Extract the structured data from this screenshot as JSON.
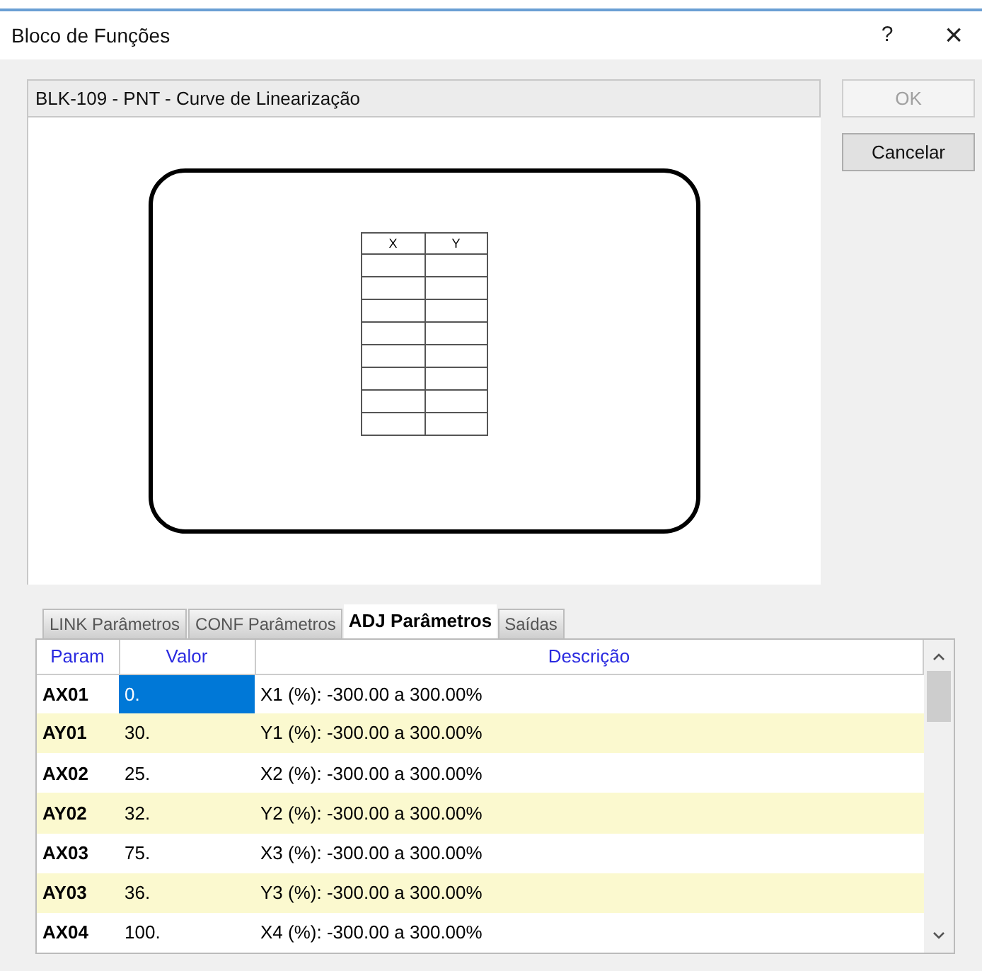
{
  "window": {
    "title": "Bloco de Funções",
    "help": "?",
    "close": "×"
  },
  "block_name": "BLK-109 - PNT - Curve de Linearização",
  "buttons": [
    {
      "label": "OK",
      "disabled": true
    },
    {
      "label": "Cancelar",
      "disabled": false
    }
  ],
  "diagram": {
    "columns": [
      "X",
      "Y"
    ]
  },
  "tabs": [
    {
      "label": "LINK Parâmetros",
      "selected": false
    },
    {
      "label": "CONF Parâmetros",
      "selected": false
    },
    {
      "label": "ADJ Parâmetros",
      "selected": true
    },
    {
      "label": "Saídas",
      "selected": false
    }
  ],
  "table": {
    "columns": [
      "Param",
      "Valor",
      "Descrição"
    ],
    "rows": [
      {
        "param": "AX01",
        "value": "0.",
        "description": "X1 (%): -300.00 a 300.00%",
        "highlighted": false,
        "selected": true
      },
      {
        "param": "AY01",
        "value": "30.",
        "description": "Y1 (%): -300.00 a 300.00%",
        "highlighted": true,
        "selected": false
      },
      {
        "param": "AX02",
        "value": "25.",
        "description": "X2 (%): -300.00 a 300.00%",
        "highlighted": false,
        "selected": false
      },
      {
        "param": "AY02",
        "value": "32.",
        "description": "Y2 (%): -300.00 a 300.00%",
        "highlighted": true,
        "selected": false
      },
      {
        "param": "AX03",
        "value": "75.",
        "description": "X3 (%): -300.00 a 300.00%",
        "highlighted": false,
        "selected": false
      },
      {
        "param": "AY03",
        "value": "36.",
        "description": "Y3 (%): -300.00 a 300.00%",
        "highlighted": true,
        "selected": false
      },
      {
        "param": "AX04",
        "value": "100.",
        "description": "X4 (%): -300.00 a 300.00%",
        "highlighted": false,
        "selected": false
      }
    ]
  }
}
